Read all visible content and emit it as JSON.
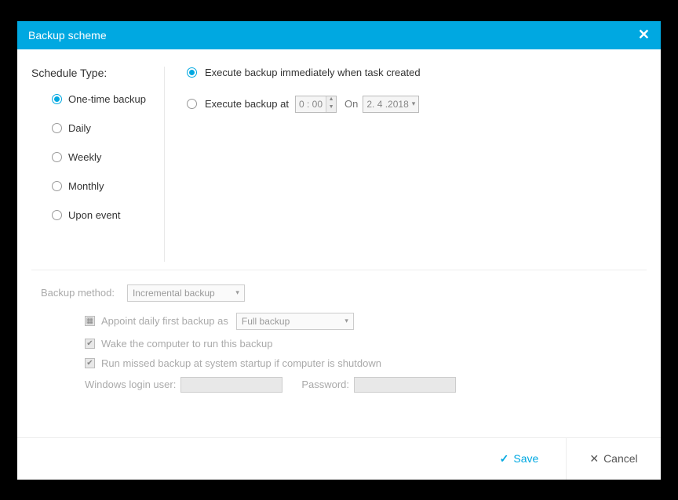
{
  "titlebar": {
    "title": "Backup scheme"
  },
  "schedule": {
    "heading": "Schedule Type:",
    "options": {
      "onetime": "One-time backup",
      "daily": "Daily",
      "weekly": "Weekly",
      "monthly": "Monthly",
      "event": "Upon event"
    }
  },
  "execute": {
    "immediately": "Execute backup immediately when task created",
    "at_label": "Execute backup at",
    "time_h": "0",
    "time_m": "00",
    "on_label": "On",
    "date": "2. 4 .2018"
  },
  "method": {
    "label": "Backup method:",
    "value": "Incremental backup",
    "appoint_label": "Appoint daily first backup as",
    "appoint_value": "Full backup",
    "wake_label": "Wake the computer to run this backup",
    "run_missed_label": "Run missed backup at system startup if computer is shutdown",
    "user_label": "Windows login user:",
    "pw_label": "Password:"
  },
  "footer": {
    "save": "Save",
    "cancel": "Cancel"
  }
}
